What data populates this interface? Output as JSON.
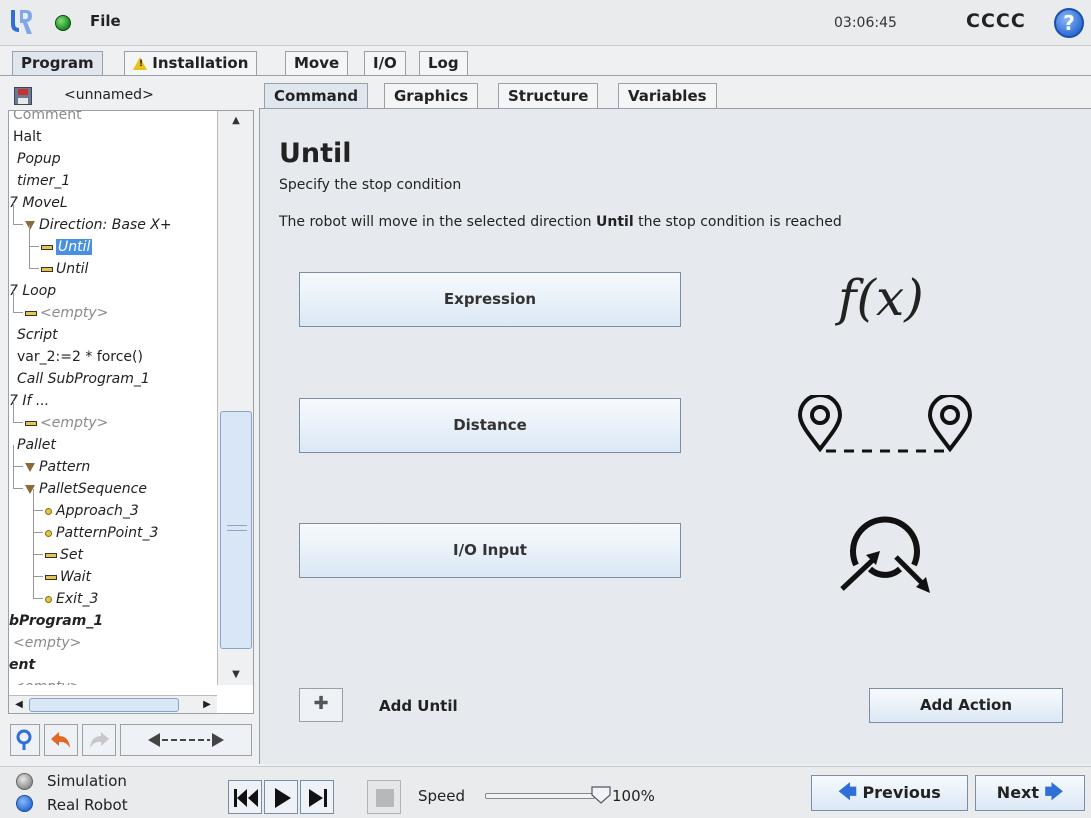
{
  "titlebar": {
    "file_label": "File",
    "clock": "03:06:45",
    "robot_name": "CCCC",
    "help_symbol": "?"
  },
  "main_tabs": [
    {
      "label": "Program",
      "active": true
    },
    {
      "label": "Installation",
      "icon": "warning-icon"
    },
    {
      "label": "Move"
    },
    {
      "label": "I/O"
    },
    {
      "label": "Log"
    }
  ],
  "left": {
    "program_name": "<unnamed>",
    "tree": [
      {
        "label": "Comment",
        "style": "gray"
      },
      {
        "label": "Halt"
      },
      {
        "label": "Popup",
        "style": "italic"
      },
      {
        "label": "timer_1",
        "style": "italic"
      },
      {
        "label": "7 MoveL",
        "style": "italic"
      },
      {
        "label": "Direction: Base X+",
        "style": "italic",
        "icon": "triangle"
      },
      {
        "label": "Until",
        "style": "italic",
        "icon": "bar",
        "selected": true
      },
      {
        "label": "Until",
        "style": "italic",
        "icon": "bar"
      },
      {
        "label": "7 Loop",
        "style": "italic"
      },
      {
        "label": "<empty>",
        "style": "italic gray",
        "icon": "bar"
      },
      {
        "label": "Script",
        "style": "italic"
      },
      {
        "label": "var_2:=2 * force()"
      },
      {
        "label": "Call SubProgram_1",
        "style": "italic"
      },
      {
        "label": "7 If ...",
        "style": "italic"
      },
      {
        "label": "<empty>",
        "style": "italic gray",
        "icon": "bar"
      },
      {
        "label": "Pallet",
        "style": "italic"
      },
      {
        "label": "Pattern",
        "style": "italic",
        "icon": "triangle"
      },
      {
        "label": "PalletSequence",
        "style": "italic",
        "icon": "triangle"
      },
      {
        "label": "Approach_3",
        "style": "italic",
        "icon": "dot"
      },
      {
        "label": "PatternPoint_3",
        "style": "italic",
        "icon": "dot"
      },
      {
        "label": "Set",
        "style": "italic",
        "icon": "bar"
      },
      {
        "label": "Wait",
        "style": "italic",
        "icon": "bar"
      },
      {
        "label": "Exit_3",
        "style": "italic",
        "icon": "dot"
      },
      {
        "label": "bProgram_1",
        "style": "italic bold"
      },
      {
        "label": "<empty>",
        "style": "italic gray"
      },
      {
        "label": "ent",
        "style": "italic bold"
      },
      {
        "label": "<empty>",
        "style": "italic gray"
      }
    ]
  },
  "subtabs": [
    {
      "label": "Command",
      "active": true
    },
    {
      "label": "Graphics"
    },
    {
      "label": "Structure"
    },
    {
      "label": "Variables"
    }
  ],
  "content": {
    "heading": "Until",
    "subheading": "Specify the stop condition",
    "description_pre": "The robot will move in the selected direction ",
    "description_bold": "Until",
    "description_post": " the stop condition is reached",
    "options": [
      {
        "label": "Expression",
        "icon": "function-icon"
      },
      {
        "label": "Distance",
        "icon": "distance-icon"
      },
      {
        "label": "I/O Input",
        "icon": "io-input-icon"
      }
    ],
    "fx_symbol": "f(x)",
    "add_until": "Add Until",
    "add_action": "Add Action"
  },
  "footer": {
    "simulation": "Simulation",
    "real_robot": "Real Robot",
    "speed_label": "Speed",
    "speed_value": "100%",
    "speed_fraction": 1.0,
    "previous": "Previous",
    "next": "Next"
  },
  "colors": {
    "accent": "#2f6fd6",
    "selection": "#4a90e2",
    "warning": "#e8c21a"
  }
}
